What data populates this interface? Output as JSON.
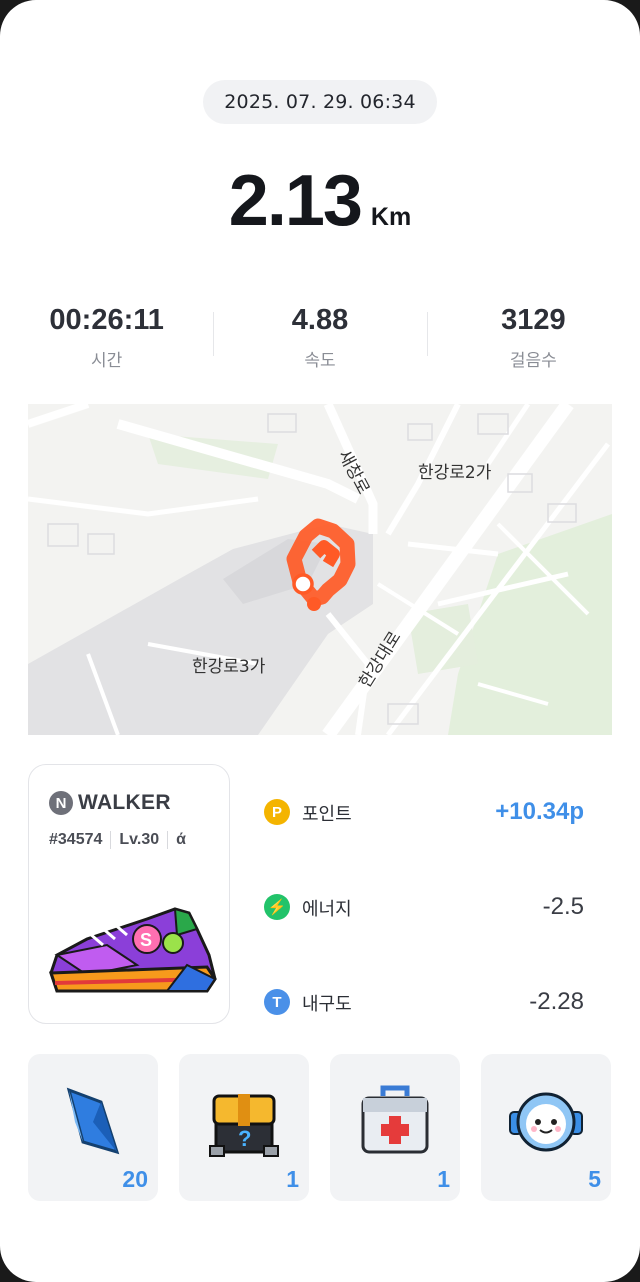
{
  "header": {
    "datetime": "2025. 07. 29. 06:34"
  },
  "distance": {
    "value": "2.13",
    "unit": "Km"
  },
  "stats": [
    {
      "value": "00:26:11",
      "label": "시간"
    },
    {
      "value": "4.88",
      "label": "속도"
    },
    {
      "value": "3129",
      "label": "걸음수"
    }
  ],
  "map": {
    "labels": {
      "area_top_right": "한강로2가",
      "area_left": "한강로3가",
      "road_saechang": "새창로",
      "road_hangang": "한강대로"
    },
    "route_color": "#ff5a26"
  },
  "shoe": {
    "brand_letter": "N",
    "brand_name": "WALKER",
    "id": "#34574",
    "level": "Lv.30",
    "badge": "ά"
  },
  "rewards": [
    {
      "icon": "point-coin-icon",
      "glyph": "P",
      "color": "#f4b400",
      "label": "포인트",
      "value": "+10.34p"
    },
    {
      "icon": "energy-bolt-icon",
      "glyph": "⚡",
      "color": "#22c36a",
      "label": "에너지",
      "value": "-2.5"
    },
    {
      "icon": "durability-icon",
      "glyph": "T",
      "color": "#4a90e8",
      "label": "내구도",
      "value": "-2.28"
    }
  ],
  "items": [
    {
      "icon": "blue-crystal-icon",
      "qty": "20"
    },
    {
      "icon": "mystery-box-icon",
      "qty": "1"
    },
    {
      "icon": "first-aid-kit-icon",
      "qty": "1"
    },
    {
      "icon": "robot-head-icon",
      "qty": "5"
    }
  ],
  "colors": {
    "accent": "#3f8fe8",
    "route": "#ff5a26"
  }
}
